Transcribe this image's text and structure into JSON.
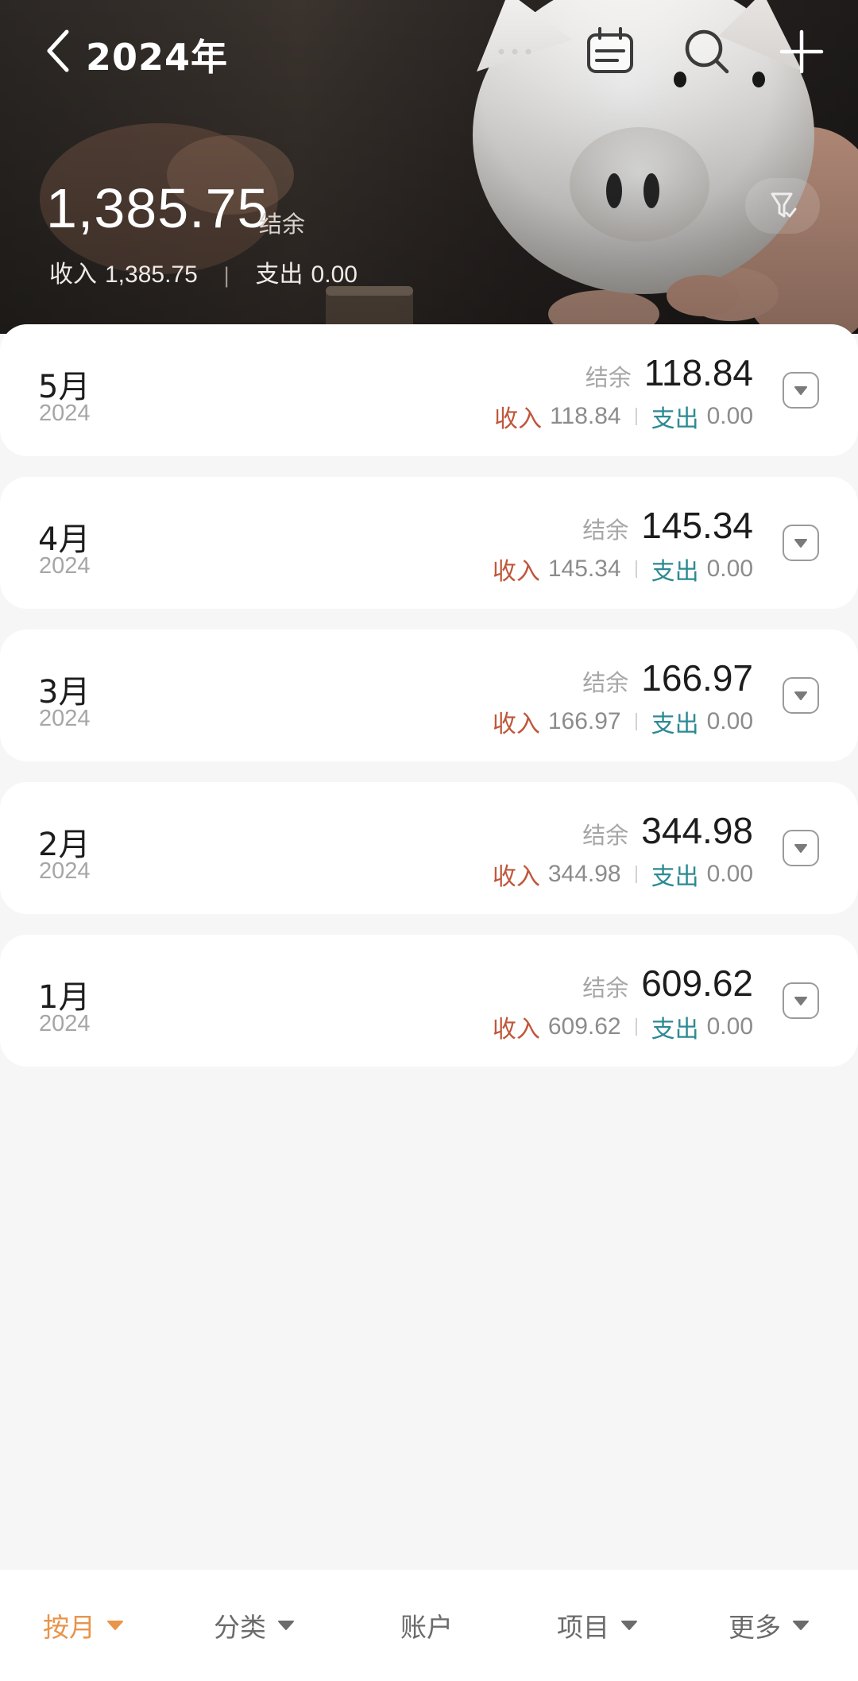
{
  "header": {
    "title": "2024年",
    "balance": "1,385.75",
    "balance_label": "结余",
    "income_label": "收入",
    "income": "1,385.75",
    "expense_label": "支出",
    "expense": "0.00",
    "icons": [
      "back-chevron-icon",
      "more-dots-icon",
      "calendar-icon",
      "search-icon",
      "plus-icon",
      "filter-funnel-icon"
    ]
  },
  "months": [
    {
      "month": "5月",
      "year": "2024",
      "balance_label": "结余",
      "balance": "118.84",
      "income_label": "收入",
      "income": "118.84",
      "expense_label": "支出",
      "expense": "0.00"
    },
    {
      "month": "4月",
      "year": "2024",
      "balance_label": "结余",
      "balance": "145.34",
      "income_label": "收入",
      "income": "145.34",
      "expense_label": "支出",
      "expense": "0.00"
    },
    {
      "month": "3月",
      "year": "2024",
      "balance_label": "结余",
      "balance": "166.97",
      "income_label": "收入",
      "income": "166.97",
      "expense_label": "支出",
      "expense": "0.00"
    },
    {
      "month": "2月",
      "year": "2024",
      "balance_label": "结余",
      "balance": "344.98",
      "income_label": "收入",
      "income": "344.98",
      "expense_label": "支出",
      "expense": "0.00"
    },
    {
      "month": "1月",
      "year": "2024",
      "balance_label": "结余",
      "balance": "609.62",
      "income_label": "收入",
      "income": "609.62",
      "expense_label": "支出",
      "expense": "0.00"
    }
  ],
  "bottom_nav": [
    {
      "label": "按月",
      "active": true,
      "has_dropdown": true
    },
    {
      "label": "分类",
      "active": false,
      "has_dropdown": true
    },
    {
      "label": "账户",
      "active": false,
      "has_dropdown": false
    },
    {
      "label": "项目",
      "active": false,
      "has_dropdown": true
    },
    {
      "label": "更多",
      "active": false,
      "has_dropdown": true
    }
  ],
  "colors": {
    "income": "#c0563a",
    "expense": "#2c8a93",
    "active_tab": "#e8944a",
    "background": "#f6f6f6"
  }
}
